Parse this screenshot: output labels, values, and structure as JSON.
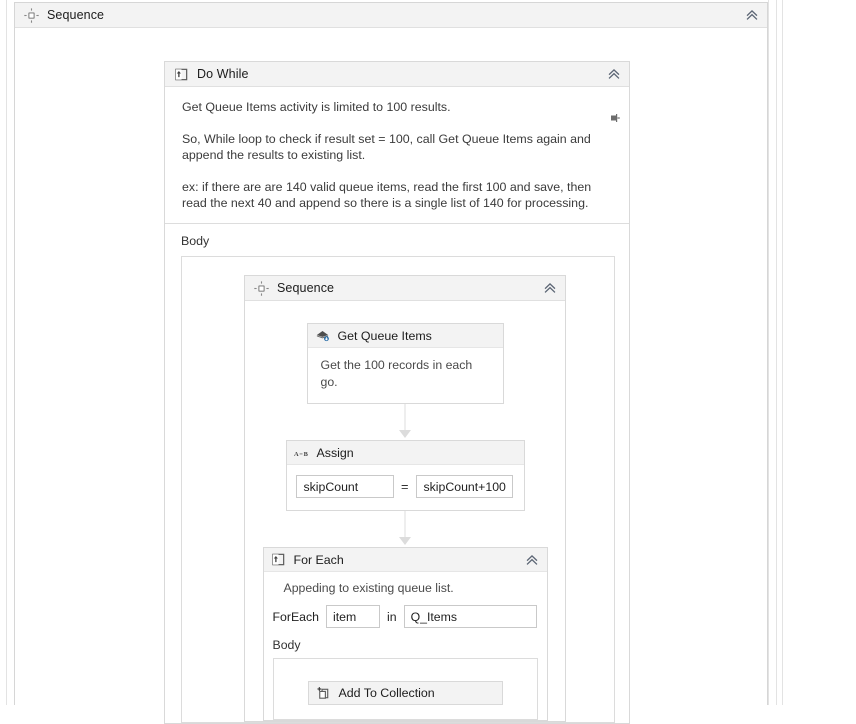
{
  "designer": {
    "root_activity": {
      "name": "root-sequence",
      "title": "Sequence",
      "icon": "sequence-icon",
      "collapse_icon": "chevron-double-up-icon"
    },
    "do_while": {
      "title": "Do While",
      "icon": "do-while-icon",
      "collapse_icon": "chevron-double-up-icon",
      "pin_icon": "annotation-pin-icon",
      "annotation": [
        "Get Queue Items activity is limited to 100 results.",
        "So, While loop to check if  result set = 100, call Get Queue Items again and append the results to existing list.",
        "ex: if there are are 140 valid queue items, read the first 100 and save, then read the next 40 and append so there is a single list of 140 for processing."
      ],
      "body_label": "Body"
    },
    "inner_sequence": {
      "title": "Sequence",
      "icon": "sequence-icon",
      "collapse_icon": "chevron-double-up-icon"
    },
    "get_queue_items": {
      "title": "Get Queue Items",
      "icon": "get-queue-items-icon",
      "note": "Get the 100 records in each go."
    },
    "assign": {
      "title": "Assign",
      "icon": "assign-ab-icon",
      "left_value": "skipCount",
      "operator": "=",
      "right_value": "skipCount+100"
    },
    "for_each": {
      "title": "For Each",
      "icon": "for-each-icon",
      "collapse_icon": "chevron-double-up-icon",
      "note": "Appeding to existing queue list.",
      "foreach_label": "ForEach",
      "item_variable": "item",
      "in_label": "in",
      "collection": "Q_Items",
      "body_label": "Body"
    },
    "add_to_collection": {
      "title": "Add To Collection",
      "icon": "add-to-collection-icon"
    },
    "colors": {
      "header_bg": "#f3f3f3",
      "border": "#d9d9d9",
      "canvas_bg": "#ffffff",
      "connector": "#dcdcdc",
      "text": "#1c1c1c",
      "muted_text": "#4a4a4a"
    }
  }
}
